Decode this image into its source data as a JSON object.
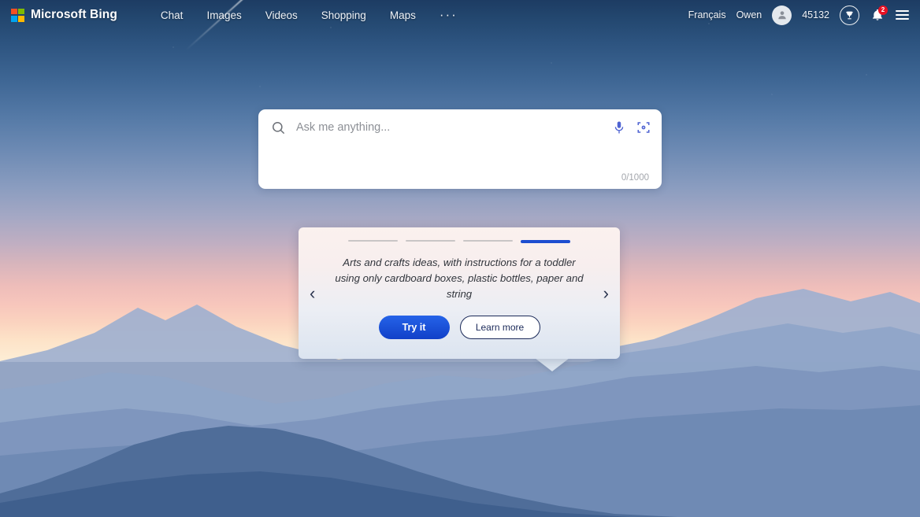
{
  "header": {
    "brand": "Microsoft Bing",
    "logo_icon": "microsoft-logo-icon",
    "nav": [
      {
        "label": "Chat",
        "name": "chat"
      },
      {
        "label": "Images",
        "name": "images"
      },
      {
        "label": "Videos",
        "name": "videos"
      },
      {
        "label": "Shopping",
        "name": "shopping"
      },
      {
        "label": "Maps",
        "name": "maps"
      },
      {
        "label": "···",
        "name": "more"
      }
    ],
    "language": "Français",
    "user_name": "Owen",
    "avatar_icon": "person-avatar-icon",
    "rewards_points": "45132",
    "rewards_icon": "trophy-icon",
    "notifications_icon": "bell-icon",
    "notifications_count": "2",
    "menu_icon": "hamburger-menu-icon"
  },
  "search": {
    "search_icon": "search-icon",
    "placeholder": "Ask me anything...",
    "value": "",
    "mic_icon": "microphone-icon",
    "lens_icon": "visual-search-icon",
    "char_counter": "0/1000"
  },
  "promo_card": {
    "slides_total": 4,
    "active_slide": 4,
    "prev_icon": "chevron-left-icon",
    "next_icon": "chevron-right-icon",
    "prev_label": "‹",
    "next_label": "›",
    "text": "Arts and crafts ideas, with instructions for a toddler using only cardboard boxes, plastic bottles, paper and string",
    "primary_button": "Try it",
    "secondary_button": "Learn more"
  },
  "colors": {
    "accent_blue": "#1d4ed0",
    "badge_red": "#e81123",
    "sky_top": "#1d3c63",
    "sky_bottom": "#fdeed6",
    "card_border_navy": "#1b2a59"
  }
}
